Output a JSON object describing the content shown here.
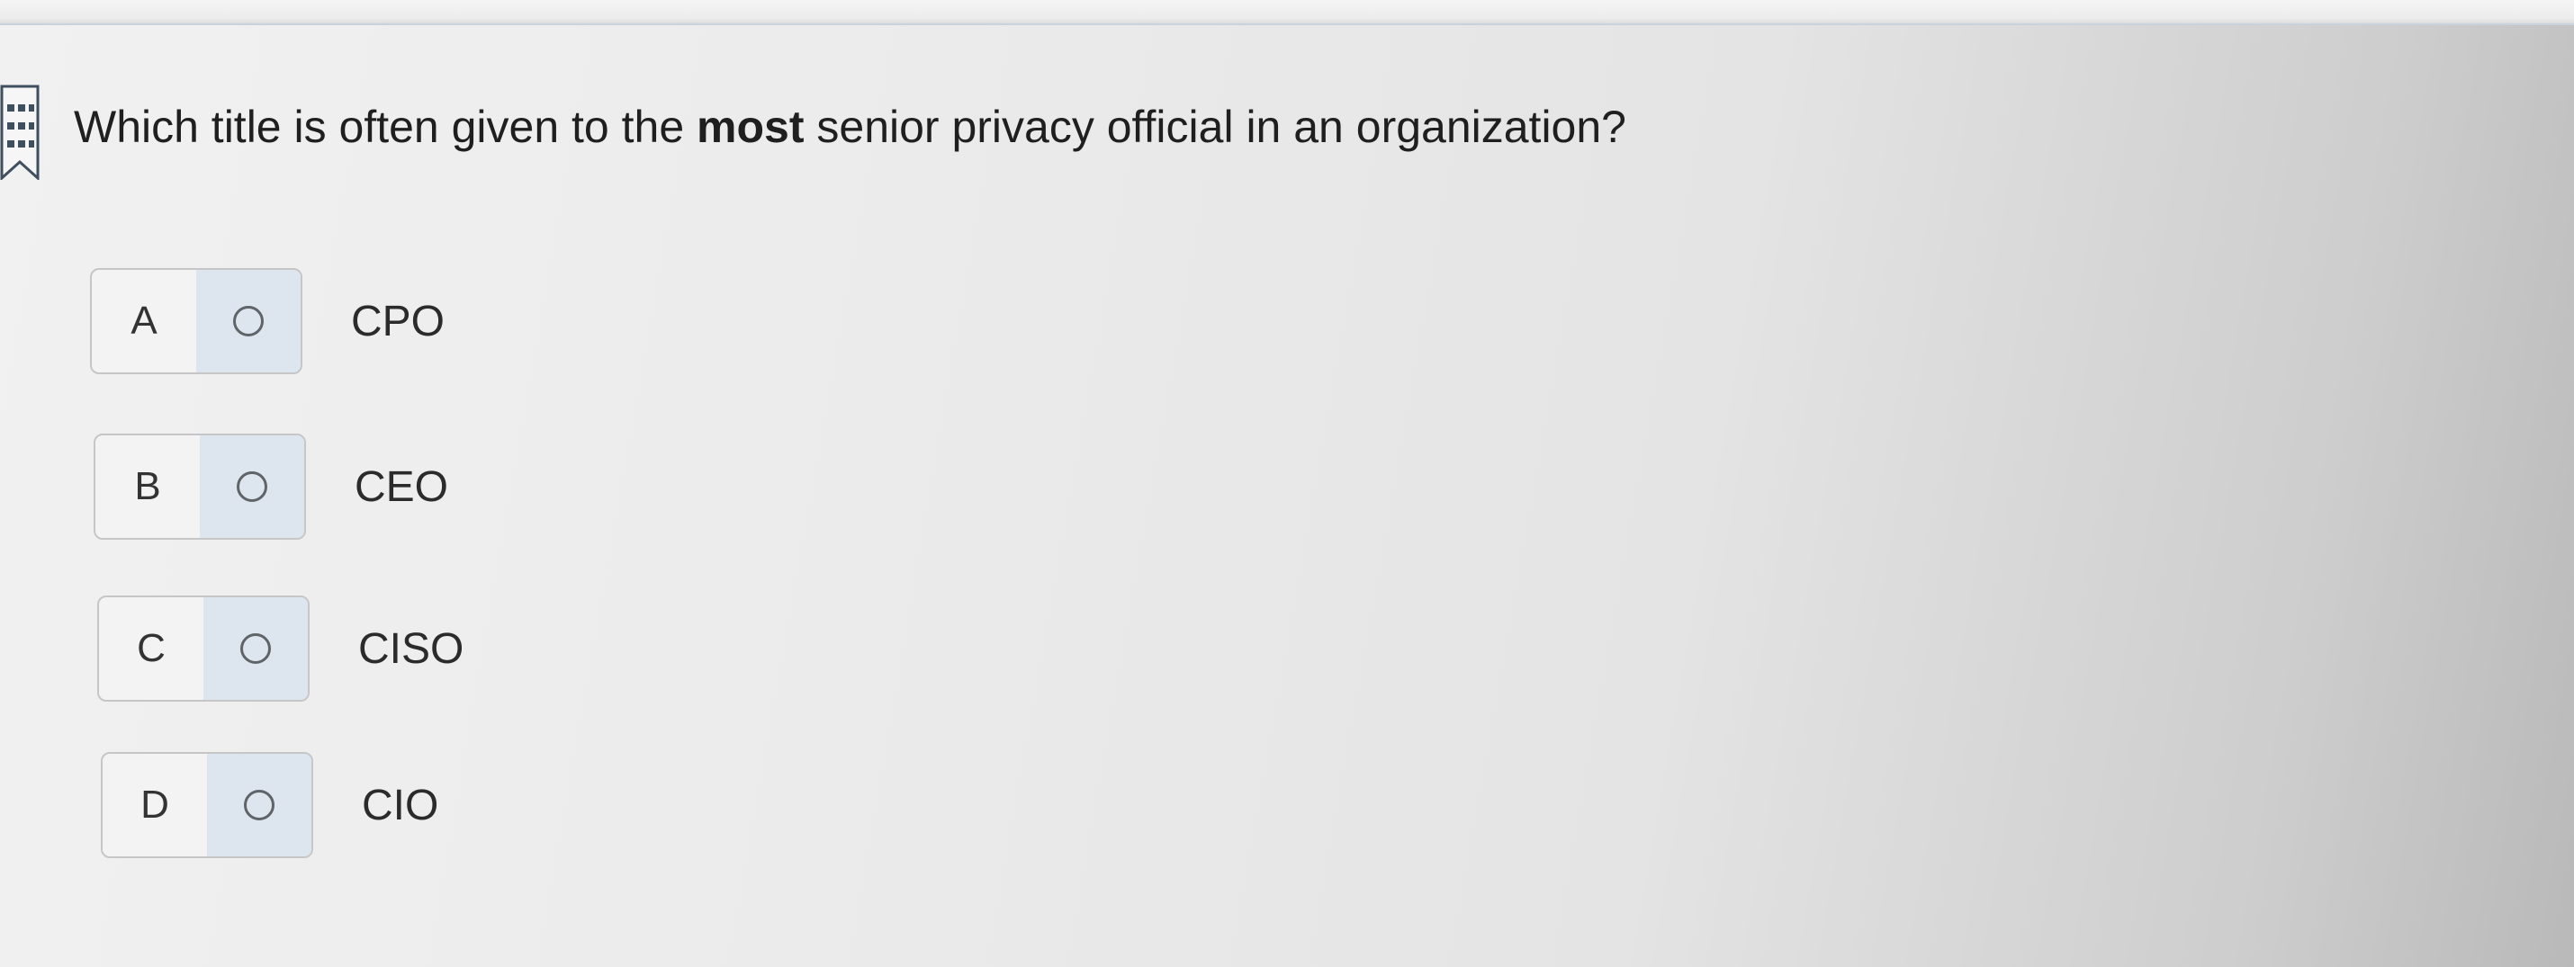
{
  "question": {
    "prefix": "Which title is often given to the ",
    "emphasis": "most",
    "suffix": " senior privacy official in an organization?"
  },
  "options": [
    {
      "letter": "A",
      "text": "CPO"
    },
    {
      "letter": "B",
      "text": "CEO"
    },
    {
      "letter": "C",
      "text": "CISO"
    },
    {
      "letter": "D",
      "text": "CIO"
    }
  ],
  "colors": {
    "radio_cell_bg": "#dde6ee",
    "bookmark_accent": "#3f4f5f"
  },
  "icons": {
    "bookmark": "bookmark-flag-icon",
    "radio": "radio-unselected-icon"
  }
}
